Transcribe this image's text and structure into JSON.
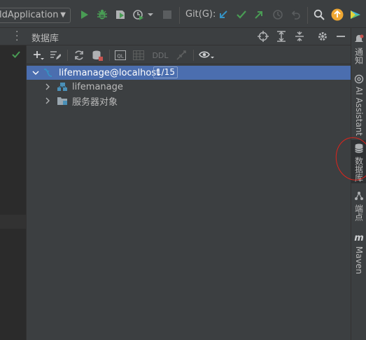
{
  "toolbar": {
    "run_config": "ldApplication",
    "git_label": "Git(G):",
    "colors": {
      "run": "#499c54",
      "debug": "#499c54",
      "git_update": "#3592c4",
      "git_commit": "#499c54",
      "git_push": "#499c54",
      "update_badge": "#f0a732"
    },
    "icons": [
      "run-icon",
      "debug-icon",
      "coverage-icon",
      "profile-icon",
      "stop-icon",
      "git-update-icon",
      "git-commit-icon",
      "git-push-icon",
      "history-icon",
      "rollback-icon",
      "search-icon",
      "update-icon",
      "plugin-icon"
    ]
  },
  "db_panel": {
    "title": "数据库",
    "header_icons": [
      "locate-icon",
      "expand-all-icon",
      "collapse-all-icon",
      "settings-icon",
      "hide-icon"
    ],
    "toolbar_icons": [
      "add-icon",
      "properties-icon",
      "refresh-icon",
      "stop-icon",
      "query-console-icon",
      "table-editor-icon",
      "ddl-icon",
      "jump-to-source-icon",
      "view-options-icon"
    ],
    "ql_label": "QL",
    "ddl_label": "DDL",
    "tree": [
      {
        "label": "lifemanage@localhost",
        "badge": "1/15",
        "selected": true,
        "expanded": true,
        "icon": "datasource-icon"
      },
      {
        "label": "lifemanage",
        "selected": false,
        "expanded": false,
        "icon": "schema-icon"
      },
      {
        "label": "服务器对象",
        "selected": false,
        "expanded": false,
        "icon": "server-objects-icon"
      }
    ]
  },
  "right_stripe": {
    "items": [
      {
        "label": "通知",
        "icon": "notification-icon",
        "active": false
      },
      {
        "label": "AI Assistant",
        "icon": "ai-assistant-icon",
        "active": false
      },
      {
        "label": "数据库",
        "icon": "database-icon",
        "active": true
      },
      {
        "label": "端点",
        "icon": "endpoints-icon",
        "active": false
      },
      {
        "label": "Maven",
        "icon": "maven-icon",
        "active": false
      }
    ]
  },
  "annotation": {
    "color": "#e0241c"
  }
}
